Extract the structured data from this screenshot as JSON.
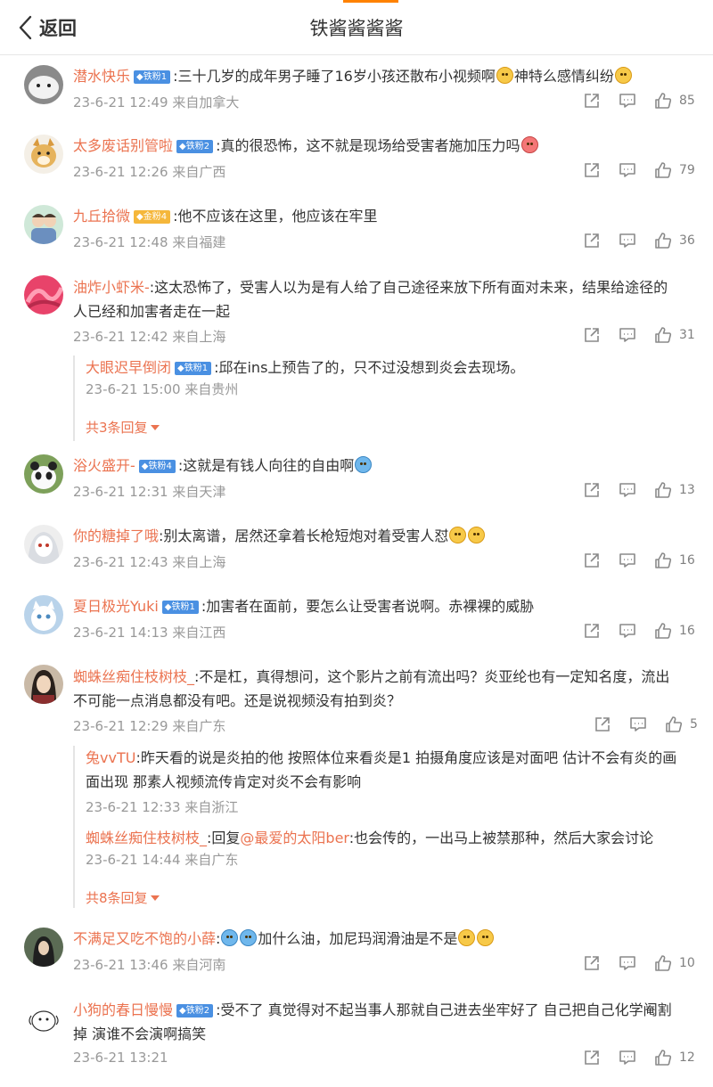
{
  "header": {
    "back_label": "返回",
    "title": "铁酱酱酱酱"
  },
  "comments": [
    {
      "user": "潜水快乐",
      "badge": "铁粉1",
      "text_before": ":三十几岁的成年男子睡了16岁小孩还散布小视频啊",
      "text_after": "神特么感情纠纷",
      "date": "23-6-21 12:49",
      "location": "来自加拿大",
      "likes": "85"
    },
    {
      "user": "太多废话别管啦",
      "badge": "铁粉2",
      "text": ":真的很恐怖，这不就是现场给受害者施加压力吗",
      "date": "23-6-21 12:26",
      "location": "来自广西",
      "likes": "79"
    },
    {
      "user": "九丘拾微",
      "badge": "金粉4",
      "text": ":他不应该在这里，他应该在牢里",
      "date": "23-6-21 12:48",
      "location": "来自福建",
      "likes": "36"
    },
    {
      "user": "油炸小虾米-",
      "text_line1": ":这太恐怖了，受害人以为是有人给了自己途径来放下所有面对未来，结果给途径的",
      "text_line2": "人已经和加害者走在一起",
      "date": "23-6-21 12:42",
      "location": "来自上海",
      "likes": "31",
      "reply": {
        "user": "大眼迟早倒闭",
        "badge": "铁粉1",
        "text": ":邱在ins上预告了的，只不过没想到炎会去现场。",
        "date": "23-6-21 15:00",
        "location": "来自贵州"
      },
      "more": "共3条回复"
    },
    {
      "user": "浴火盛开-",
      "badge": "铁粉4",
      "text": ":这就是有钱人向往的自由啊",
      "date": "23-6-21 12:31",
      "location": "来自天津",
      "likes": "13"
    },
    {
      "user": "你的糖掉了哦",
      "text": ":别太离谱，居然还拿着长枪短炮对着受害人怼",
      "date": "23-6-21 12:43",
      "location": "来自上海",
      "likes": "16"
    },
    {
      "user": "夏日极光Yuki",
      "badge": "铁粉1",
      "text": ":加害者在面前，要怎么让受害者说啊。赤裸裸的威胁",
      "date": "23-6-21 14:13",
      "location": "来自江西",
      "likes": "16"
    },
    {
      "user": "蜘蛛丝痴住枝树枝_",
      "text_line1": ":不是杠，真得想问，这个影片之前有流出吗？炎亚纶也有一定知名度，流出",
      "text_line2": "不可能一点消息都没有吧。还是说视频没有拍到炎？",
      "date": "23-6-21 12:29",
      "location": "来自广东",
      "likes": "5",
      "replies": [
        {
          "user": "兔vvTU",
          "text_line1": ":昨天看的说是炎拍的他 按照体位来看炎是1 拍摄角度应该是对面吧 估计不会有炎的画",
          "text_line2": "面出现 那素人视频流传肯定对炎不会有影响",
          "date": "23-6-21 12:33",
          "location": "来自浙江"
        },
        {
          "user": "蜘蛛丝痴住枝树枝_",
          "text_a": ":回复",
          "mention": "@最爱的太阳ber",
          "text_b": ":也会传的，一出马上被禁那种，然后大家会讨论",
          "date": "23-6-21 14:44",
          "location": "来自广东"
        }
      ],
      "more": "共8条回复"
    },
    {
      "user": "不满足又吃不饱的小薛",
      "text": "加什么油，加尼玛润滑油是不是",
      "date": "23-6-21 13:46",
      "location": "来自河南",
      "likes": "10"
    },
    {
      "user": "小狗的春日慢慢",
      "badge": "铁粉2",
      "text_line1": ":受不了 真觉得对不起当事人那就自己进去坐牢好了 自己把自己化学阉割",
      "text_line2": "掉 演谁不会演啊搞笑",
      "date": "23-6-21 13:21",
      "likes": "12"
    }
  ],
  "colors": {
    "accent": "#ff8200",
    "username": "#eb7350",
    "badge_blue": "#4a90e2",
    "badge_gold": "#f5b73b",
    "meta": "#999999"
  },
  "icons": {
    "back": "chevron-left-icon",
    "share": "share-icon",
    "comment": "comment-icon",
    "like": "thumbs-up-icon"
  }
}
